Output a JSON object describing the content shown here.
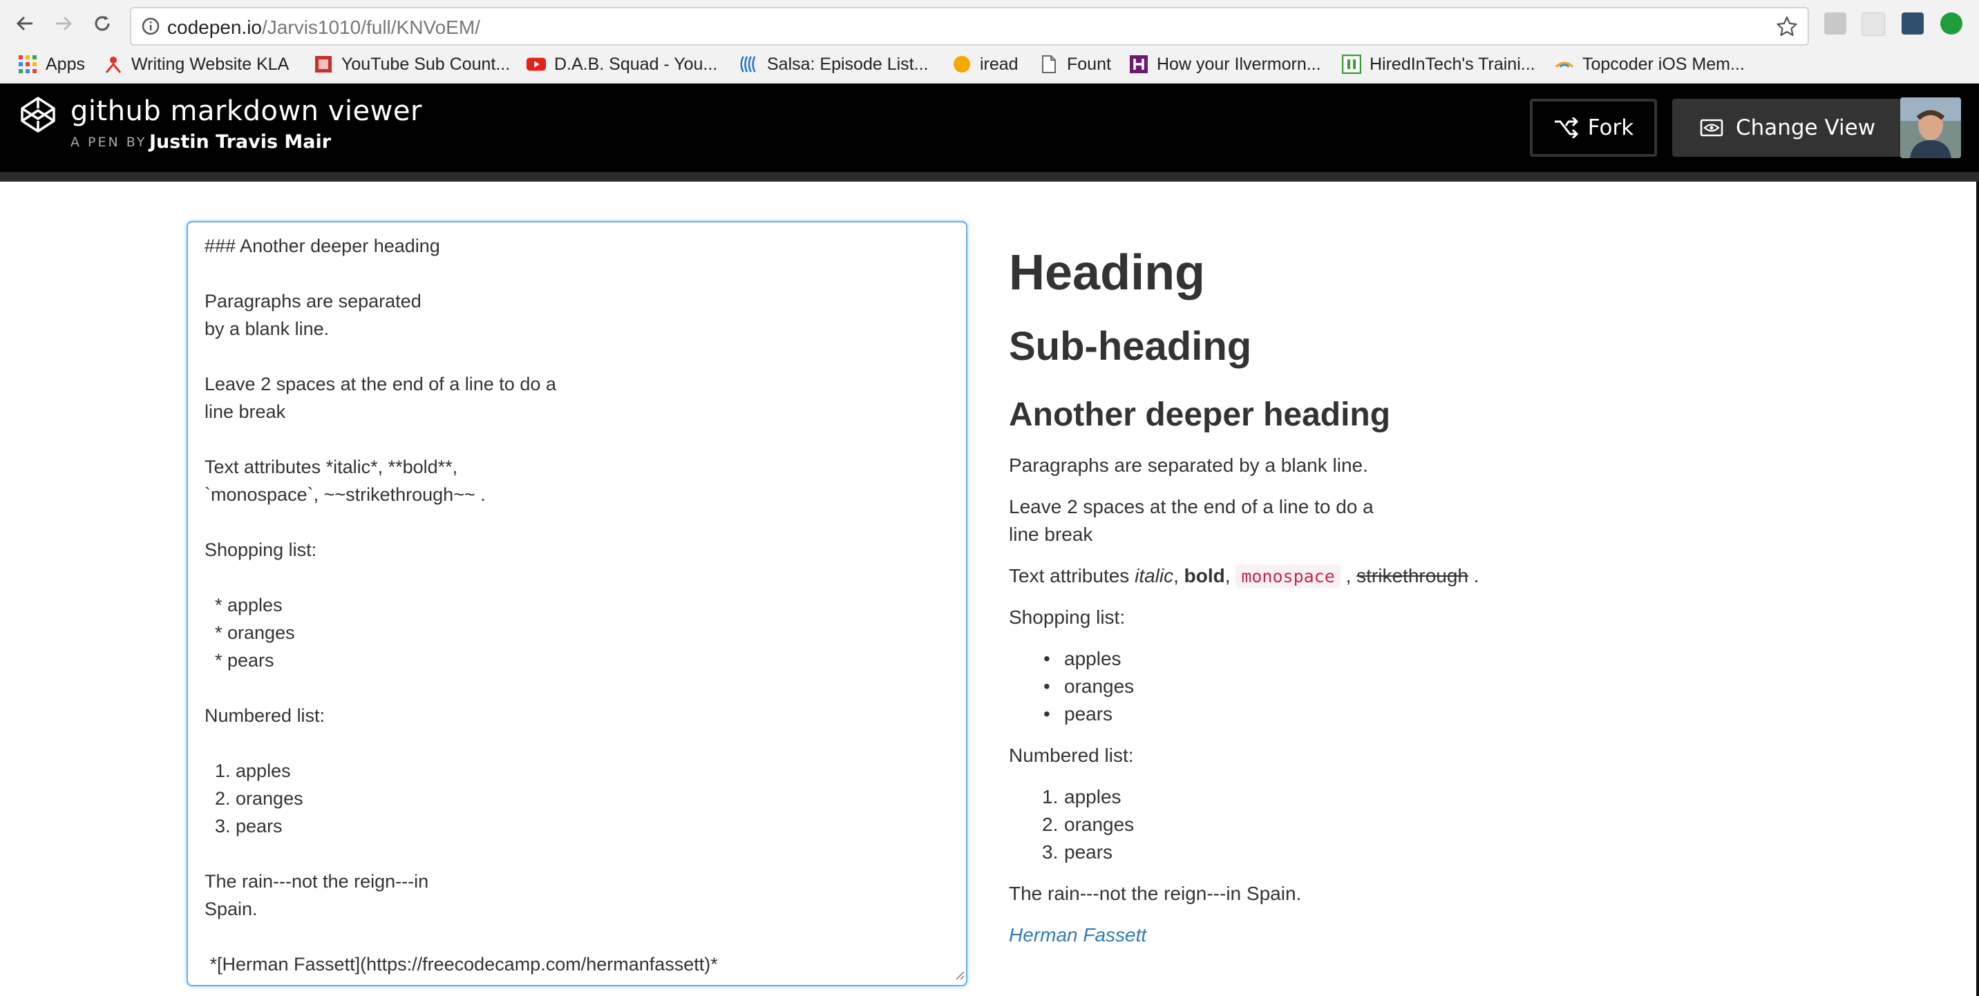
{
  "browser": {
    "url_host": "codepen.io",
    "url_path": "/Jarvis1010/full/KNVoEM/",
    "bookmarks": [
      {
        "label": "Apps",
        "icon": "apps-grid-icon"
      },
      {
        "label": "Writing Website KLA",
        "icon": "person-icon"
      },
      {
        "label": "YouTube Sub Count...",
        "icon": "youtube-counter-icon"
      },
      {
        "label": "D.A.B. Squad - You...",
        "icon": "youtube-icon"
      },
      {
        "label": "Salsa: Episode List...",
        "icon": "salsa-icon"
      },
      {
        "label": "iread",
        "icon": "circle-icon"
      },
      {
        "label": "Fount",
        "icon": "page-icon"
      },
      {
        "label": "How your Ilvermorn...",
        "icon": "h-icon"
      },
      {
        "label": "HiredInTech's Traini...",
        "icon": "hiredintech-icon"
      },
      {
        "label": "Topcoder iOS Mem...",
        "icon": "topcoder-icon"
      }
    ]
  },
  "header": {
    "title": "github markdown viewer",
    "by_label": "A PEN BY",
    "author": "Justin Travis Mair",
    "fork_label": "Fork",
    "change_view_label": "Change View"
  },
  "editor": {
    "content": "### Another deeper heading\n\nParagraphs are separated\nby a blank line.\n\nLeave 2 spaces at the end of a line to do a\nline break\n\nText attributes *italic*, **bold**,\n`monospace`, ~~strikethrough~~ .\n\nShopping list:\n\n  * apples\n  * oranges\n  * pears\n\nNumbered list:\n\n  1. apples\n  2. oranges\n  3. pears\n\nThe rain---not the reign---in\nSpain.\n\n *[Herman Fassett](https://freecodecamp.com/hermanfassett)*"
  },
  "preview": {
    "h1": "Heading",
    "h2": "Sub-heading",
    "h3": "Another deeper heading",
    "p1": "Paragraphs are separated by a blank line.",
    "p2_line1": "Leave 2 spaces at the end of a line to do a",
    "p2_line2": "line break",
    "attrs_prefix": "Text attributes ",
    "attrs_italic": "italic",
    "sep1": ", ",
    "attrs_bold": "bold",
    "sep2": ", ",
    "attrs_mono": "monospace",
    "sep3": " , ",
    "attrs_strike": "strikethrough",
    "attrs_end": " .",
    "shopping_label": "Shopping list:",
    "shopping_items": [
      "apples",
      "oranges",
      "pears"
    ],
    "numbered_label": "Numbered list:",
    "numbered_items": [
      "apples",
      "oranges",
      "pears"
    ],
    "numbered_marks": [
      "1.",
      "2.",
      "3."
    ],
    "rain": "The rain---not the reign---in Spain.",
    "link_text": "Herman Fassett"
  },
  "colors": {
    "header_bg": "#000000",
    "link": "#337ab7",
    "code_text": "#c7254e",
    "editor_focus_border": "#66afe9"
  }
}
